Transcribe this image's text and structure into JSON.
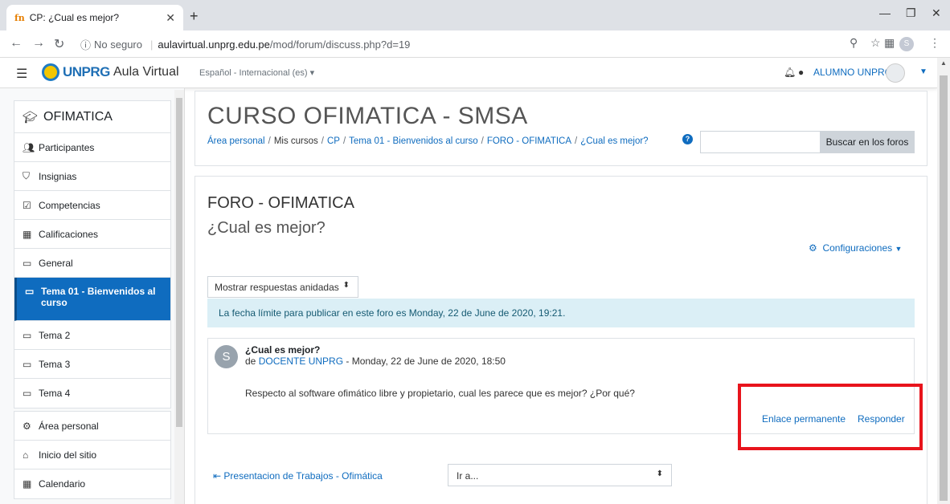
{
  "browser": {
    "tab_title": "CP: ¿Cual es mejor?",
    "tab_favicon": "fn",
    "secure_label": "No seguro",
    "url_host": "aulavirtual.unprg.edu.pe",
    "url_path": "/mod/forum/discuss.php?d=19",
    "profile_initial": "S"
  },
  "navbar": {
    "logo_text": "UNPRG",
    "site_name": "Aula Virtual",
    "language": "Español - Internacional (es) ▾",
    "user_name": "ALUMNO UNPRG"
  },
  "drawer": {
    "course": "OFIMATICA",
    "group1": [
      {
        "icon": "users-icon",
        "glyph": "👥",
        "label": "Participantes"
      },
      {
        "icon": "badge-icon",
        "glyph": "⛉",
        "label": "Insignias"
      },
      {
        "icon": "checkbox-icon",
        "glyph": "☑",
        "label": "Competencias"
      },
      {
        "icon": "table-icon",
        "glyph": "▦",
        "label": "Calificaciones"
      },
      {
        "icon": "folder-icon",
        "glyph": "▭",
        "label": "General"
      },
      {
        "icon": "folder-icon",
        "glyph": "▭",
        "label": "Tema 01 - Bienvenidos al curso",
        "active": true
      },
      {
        "icon": "folder-icon",
        "glyph": "▭",
        "label": "Tema 2"
      },
      {
        "icon": "folder-icon",
        "glyph": "▭",
        "label": "Tema 3"
      },
      {
        "icon": "folder-icon",
        "glyph": "▭",
        "label": "Tema 4"
      }
    ],
    "group2": [
      {
        "icon": "dashboard-icon",
        "glyph": "⚙",
        "label": "Área personal"
      },
      {
        "icon": "home-icon",
        "glyph": "⌂",
        "label": "Inicio del sitio"
      },
      {
        "icon": "calendar-icon",
        "glyph": "▦",
        "label": "Calendario"
      }
    ]
  },
  "header": {
    "course_title": "CURSO OFIMATICA - SMSA",
    "breadcrumb": {
      "home": "Área personal",
      "courses": "Mis cursos",
      "course": "CP",
      "section": "Tema 01 - Bienvenidos al curso",
      "forum": "FORO - OFIMATICA",
      "discussion": "¿Cual es mejor?"
    },
    "search_placeholder": "",
    "search_button": "Buscar en los foros"
  },
  "forum": {
    "name": "FORO - OFIMATICA",
    "discussion": "¿Cual es mejor?",
    "settings_label": "Configuraciones",
    "display_mode": "Mostrar respuestas anidadas",
    "deadline_notice": "La fecha límite para publicar en este foro es Monday, 22 de June de 2020, 19:21."
  },
  "post": {
    "avatar_initial": "S",
    "subject": "¿Cual es mejor?",
    "by": "de",
    "author": "DOCENTE UNPRG",
    "date": " - Monday, 22 de June de 2020, 18:50",
    "body": "Respecto al software ofimático libre y propietario, cual les parece que es mejor? ¿Por qué?",
    "permalink_label": "Enlace permanente",
    "reply_label": "Responder"
  },
  "footer_nav": {
    "prev_link": "Presentacion de Trabajos - Ofimática",
    "jump_label": "Ir a..."
  }
}
